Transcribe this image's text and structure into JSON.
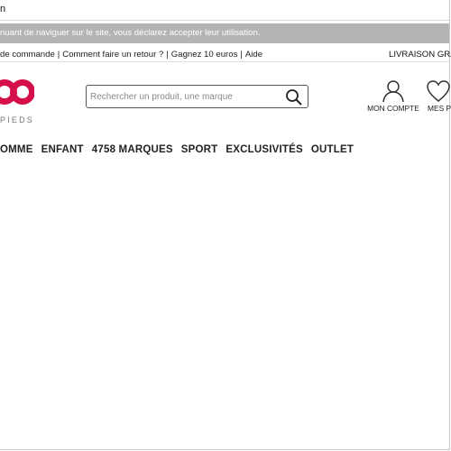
{
  "browser": {
    "url_fragment": "n"
  },
  "cookie_banner": {
    "text": "nuant de naviguer sur le site, vous déclarez accepter leur utilisation."
  },
  "top_links": {
    "items": [
      "de commande",
      "Comment faire un retour ?",
      "Gagnez 10 euros",
      "Aide"
    ],
    "separator": "|"
  },
  "promo": {
    "livraison": "LIVRAISON GRATU"
  },
  "logo": {
    "mark": "oo",
    "subtitle": "PIEDS",
    "color": "#d40f4a"
  },
  "search": {
    "placeholder": "Rechercher un produit, une marque"
  },
  "account": {
    "label": "MON COMPTE"
  },
  "favorites": {
    "label": "MES P"
  },
  "nav": {
    "items": [
      "OMME",
      "ENFANT",
      "4758 MARQUES",
      "SPORT",
      "EXCLUSIVITÉS",
      "OUTLET"
    ]
  }
}
